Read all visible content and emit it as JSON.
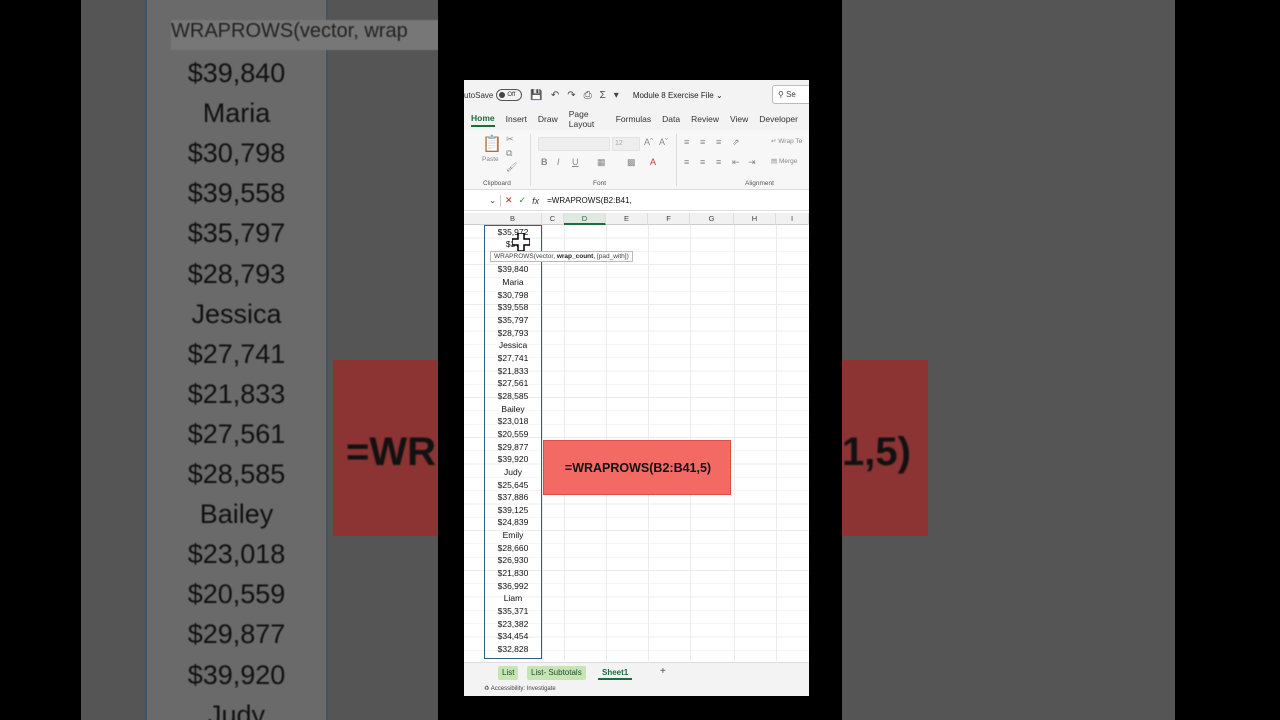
{
  "titlebar": {
    "autosave_label": "utoSave",
    "toggle_state": "Off",
    "filename": "Module 8 Exercise File",
    "filename_chevron": "⌄",
    "search_label": "Se"
  },
  "ribbon_tabs": [
    "Home",
    "Insert",
    "Draw",
    "Page Layout",
    "Formulas",
    "Data",
    "Review",
    "View",
    "Developer"
  ],
  "ribbon_groups": {
    "clipboard": "Clipboard",
    "font": "Font",
    "alignment": "Alignment",
    "paste": "Paste",
    "font_size": "12",
    "wrap_text": "Wrap Te",
    "merge": "Merge"
  },
  "formula_bar": {
    "formula": "=WRAPROWS(B2:B41,"
  },
  "column_headers": [
    "B",
    "C",
    "D",
    "E",
    "F",
    "G",
    "H",
    "I"
  ],
  "cells_b": [
    "$35,972",
    "$37",
    "",
    "$39,840",
    "Maria",
    "$30,798",
    "$39,558",
    "$35,797",
    "$28,793",
    "Jessica",
    "$27,741",
    "$21,833",
    "$27,561",
    "$28,585",
    "Bailey",
    "$23,018",
    "$20,559",
    "$29,877",
    "$39,920",
    "Judy",
    "$25,645",
    "$37,886",
    "$39,125",
    "$24,839",
    "Emily",
    "$28,660",
    "$26,930",
    "$21,830",
    "$36,992",
    "Liam",
    "$35,371",
    "$23,382",
    "$34,454",
    "$32,828"
  ],
  "tooltip": {
    "fn": "WRAPROWS(vector, ",
    "bold_arg": "wrap_count",
    "rest": ", [pad_with])"
  },
  "banner": {
    "text": "=WRAPROWS(B2:B41,5)",
    "color": "#f26a63"
  },
  "sheet_tabs": [
    "List",
    "List- Subtotals",
    "Sheet1"
  ],
  "status": {
    "accessibility": "Accessibility: Investigate"
  },
  "backdrop": {
    "left_tooltip": "WRAPROWS(vector, wrap",
    "left_cells": [
      "$39,840",
      "Maria",
      "$30,798",
      "$39,558",
      "$35,797",
      "$28,793",
      "Jessica",
      "$27,741",
      "$21,833",
      "$27,561",
      "$28,585",
      "Bailey",
      "$23,018",
      "$20,559",
      "$29,877",
      "$39,920",
      "Judy"
    ],
    "left_banner": "=WR",
    "right_banner": "1,5)"
  }
}
